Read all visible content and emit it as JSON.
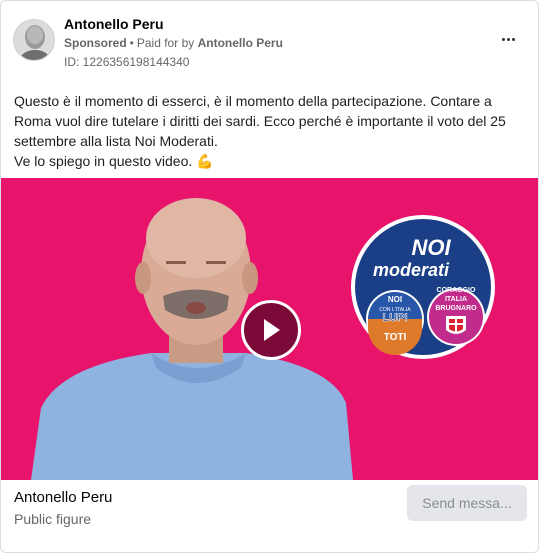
{
  "advertiser": {
    "name": "Antonello Peru",
    "sponsored_label": "Sponsored",
    "separator": "•",
    "paid_for_prefix": "Paid for by",
    "paid_for_by": "Antonello Peru",
    "ad_id": "ID: 1226356198144340",
    "avatar_icon": "person-portrait-icon"
  },
  "more_options_icon": "more-horizontal-icon",
  "ad_text": {
    "paragraph_1": "Questo è il momento di esserci, è il momento della partecipazione. Contare a Roma vuol dire tutelare i diritti dei sardi. Ecco perché è importante il voto del 25 settembre alla lista Noi Moderati.",
    "paragraph_2": "Ve lo spiego in questo video.",
    "emoji": "💪"
  },
  "video": {
    "background_color": "#e8146b",
    "play_icon": "play-icon",
    "logo": {
      "title_line_1": "NOI",
      "title_line_2": "moderati",
      "badge_left_top": "NOI",
      "badge_left_mid": "CON L'ITALIA",
      "badge_left_name": "LUPI",
      "badge_left_bottom": "TOTI",
      "badge_right_top": "CORAGGIO",
      "badge_right_mid": "ITALIA",
      "badge_right_name": "BRUGNARO"
    }
  },
  "footer": {
    "page_name": "Antonello Peru",
    "category": "Public figure",
    "send_button_label": "Send messa..."
  }
}
